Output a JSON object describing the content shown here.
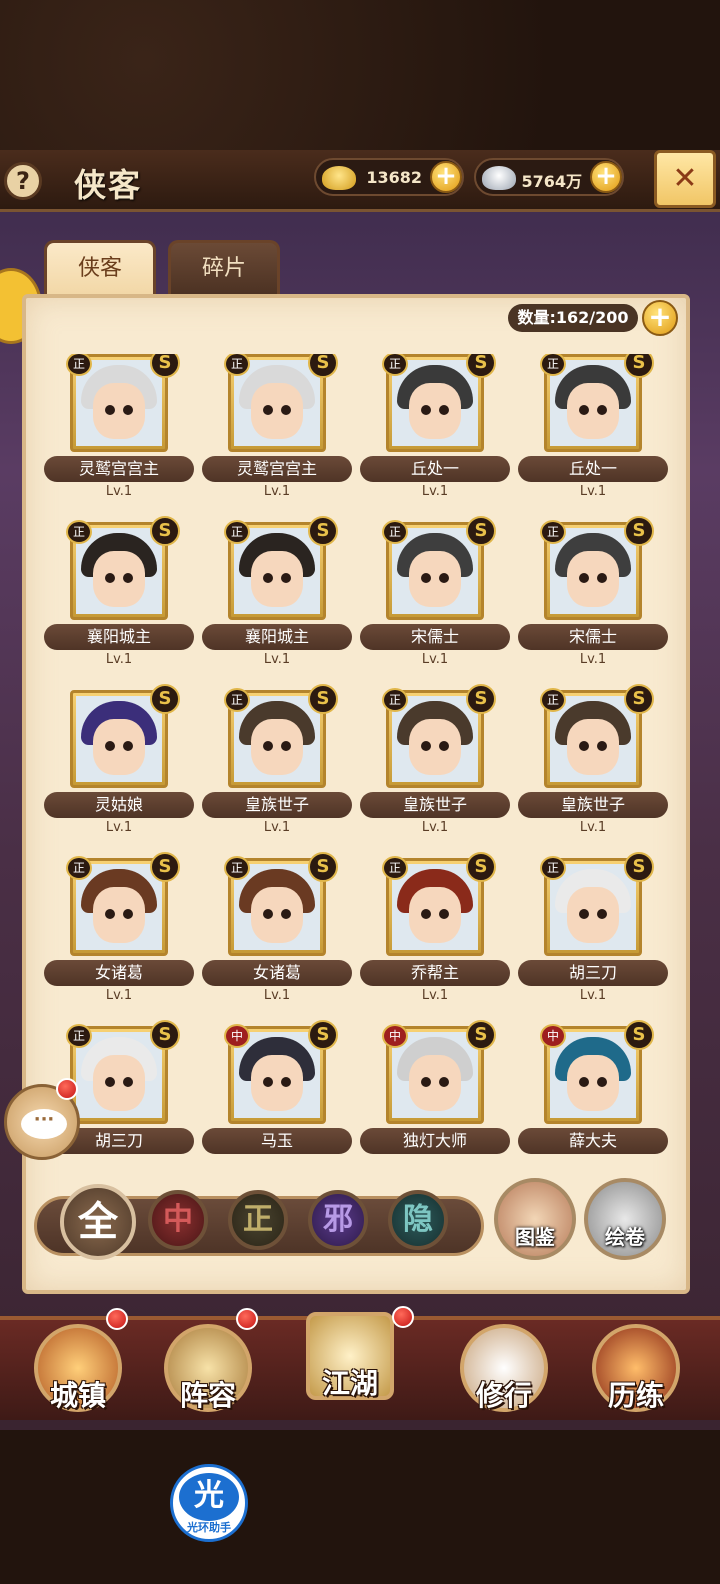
{
  "header": {
    "help_icon": "?",
    "title": "侠客",
    "gold_value": "13682",
    "silver_value": "5764万",
    "plus_icon": "+",
    "close_icon": "✕"
  },
  "tabs": [
    {
      "label": "侠客",
      "active": true
    },
    {
      "label": "碎片",
      "active": false
    }
  ],
  "count": {
    "label": "数量:162/200",
    "plus_icon": "+"
  },
  "heroes": [
    {
      "name": "灵鹫宫宫主",
      "level": "Lv.1",
      "faction": "正",
      "grade": "S",
      "hair": "#d9d9d9"
    },
    {
      "name": "灵鹫宫宫主",
      "level": "Lv.1",
      "faction": "正",
      "grade": "S",
      "hair": "#d9d9d9"
    },
    {
      "name": "丘处一",
      "level": "Lv.1",
      "faction": "正",
      "grade": "S",
      "hair": "#3a3a3a"
    },
    {
      "name": "丘处一",
      "level": "Lv.1",
      "faction": "正",
      "grade": "S",
      "hair": "#3a3a3a"
    },
    {
      "name": "襄阳城主",
      "level": "Lv.1",
      "faction": "正",
      "grade": "S",
      "hair": "#2a2420"
    },
    {
      "name": "襄阳城主",
      "level": "Lv.1",
      "faction": "正",
      "grade": "S",
      "hair": "#2a2420"
    },
    {
      "name": "宋儒士",
      "level": "Lv.1",
      "faction": "正",
      "grade": "S",
      "hair": "#3e3e3e"
    },
    {
      "name": "宋儒士",
      "level": "Lv.1",
      "faction": "正",
      "grade": "S",
      "hair": "#3e3e3e"
    },
    {
      "name": "灵姑娘",
      "level": "Lv.1",
      "faction": "",
      "grade": "S",
      "hair": "#3b2e7a"
    },
    {
      "name": "皇族世子",
      "level": "Lv.1",
      "faction": "正",
      "grade": "S",
      "hair": "#4a3a2c"
    },
    {
      "name": "皇族世子",
      "level": "Lv.1",
      "faction": "正",
      "grade": "S",
      "hair": "#4a3a2c"
    },
    {
      "name": "皇族世子",
      "level": "Lv.1",
      "faction": "正",
      "grade": "S",
      "hair": "#4a3a2c"
    },
    {
      "name": "女诸葛",
      "level": "Lv.1",
      "faction": "正",
      "grade": "S",
      "hair": "#6a3a22"
    },
    {
      "name": "女诸葛",
      "level": "Lv.1",
      "faction": "正",
      "grade": "S",
      "hair": "#6a3a22"
    },
    {
      "name": "乔帮主",
      "level": "Lv.1",
      "faction": "正",
      "grade": "S",
      "hair": "#8a2a1a"
    },
    {
      "name": "胡三刀",
      "level": "Lv.1",
      "faction": "正",
      "grade": "S",
      "hair": "#eaeaea"
    },
    {
      "name": "胡三刀",
      "level": "",
      "faction": "正",
      "grade": "S",
      "hair": "#eaeaea"
    },
    {
      "name": "马玉",
      "level": "",
      "faction": "中",
      "grade": "S",
      "hair": "#2e2e3a"
    },
    {
      "name": "独灯大师",
      "level": "",
      "faction": "中",
      "grade": "S",
      "hair": "#cfcfcf"
    },
    {
      "name": "薛大夫",
      "level": "",
      "faction": "中",
      "grade": "S",
      "hair": "#1f6a8a"
    }
  ],
  "filters": {
    "all": "全",
    "zhong": "中",
    "zheng": "正",
    "xie": "邪",
    "yin": "隐"
  },
  "side_buttons": {
    "tujian": "图鉴",
    "huijuan": "绘卷"
  },
  "chat_icon": "···",
  "bottom_nav": [
    {
      "label": "城镇"
    },
    {
      "label": "阵容"
    },
    {
      "label": "江湖"
    },
    {
      "label": "修行"
    },
    {
      "label": "历练"
    }
  ],
  "assistant": {
    "icon_text": "光",
    "label": "光环助手"
  },
  "colors": {
    "accent_gold": "#f3c133",
    "panel_bg": "#f8ead0",
    "notification_red": "#c41414"
  }
}
